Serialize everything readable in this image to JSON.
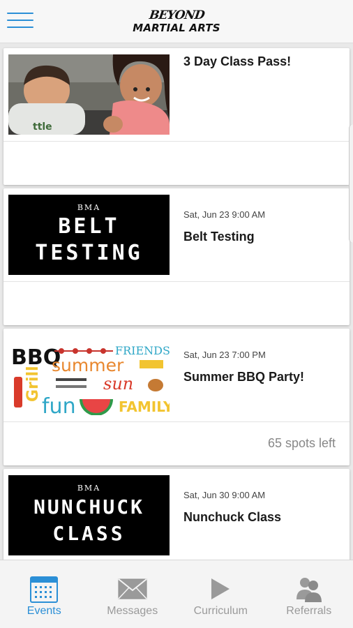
{
  "app": {
    "logo_top": "BEYOND",
    "logo_bottom": "MARTIAL ARTS",
    "colors": {
      "accent": "#2b8fd6",
      "inactive": "#9a9a9a",
      "background": "#e9e9e9"
    }
  },
  "header": {
    "menu_icon": "hamburger-menu-icon"
  },
  "events": [
    {
      "date": "",
      "title": "3 Day Class Pass!",
      "spots": "",
      "image": "kids-photo"
    },
    {
      "date": "Sat, Jun 23 9:00 AM",
      "title": "Belt Testing",
      "spots": "",
      "image": "bma-poster",
      "poster": {
        "label": "BMA",
        "line1": "BELT",
        "line2": "TESTING"
      }
    },
    {
      "date": "Sat, Jun 23 7:00 PM",
      "title": "Summer BBQ Party!",
      "spots": "65 spots left",
      "image": "bbq-collage",
      "collage": {
        "bbq": "BBQ",
        "friends": "FRIENDS",
        "summer": "summer",
        "grill": "Grill",
        "sun": "sun",
        "fun": "fun",
        "family": "FAMILY"
      }
    },
    {
      "date": "Sat, Jun 30 9:00 AM",
      "title": "Nunchuck Class",
      "spots": "",
      "image": "bma-poster",
      "poster": {
        "label": "BMA",
        "line1": "NUNCHUCK",
        "line2": "CLASS"
      }
    }
  ],
  "tabs": [
    {
      "label": "Events",
      "icon": "calendar-icon",
      "active": true
    },
    {
      "label": "Messages",
      "icon": "envelope-icon",
      "active": false
    },
    {
      "label": "Curriculum",
      "icon": "play-icon",
      "active": false
    },
    {
      "label": "Referrals",
      "icon": "people-icon",
      "active": false
    }
  ]
}
